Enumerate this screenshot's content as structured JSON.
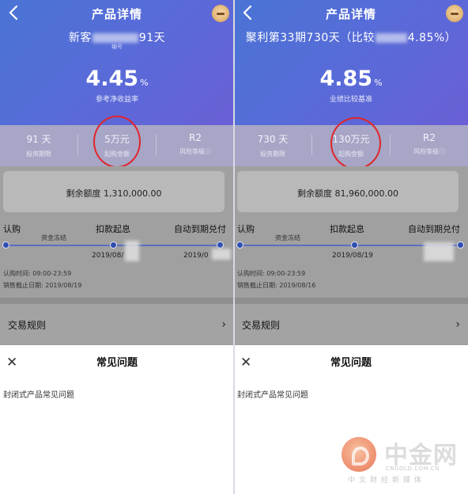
{
  "left": {
    "nav_title": "产品详情",
    "product_name_prefix": "新客",
    "product_name_suffix": "91天",
    "product_sub": "编号",
    "rate_value": "4.45",
    "rate_unit": "%",
    "rate_label": "参考净收益率",
    "stats": [
      {
        "value": "91 天",
        "label": "投资期限"
      },
      {
        "value": "5万元",
        "label": "起购金额"
      },
      {
        "value": "R2",
        "label": "风险等级"
      }
    ],
    "remaining": "剩余额度 1,310,000.00",
    "steps": [
      "认购",
      "扣款起息",
      "自动到期兑付"
    ],
    "freeze_label": "资金冻结",
    "date_a": "2019/08/",
    "date_b": "2019/0",
    "info_1": "认购时间: 09:00-23:59",
    "info_2": "销售截止日期: 2019/08/19",
    "rules_label": "交易规则",
    "faq_title": "常见问题",
    "faq_item": "封闭式产品常见问题"
  },
  "right": {
    "nav_title": "产品详情",
    "product_name_prefix": "聚利第33期730天（比较",
    "product_name_suffix": "4.85%）",
    "product_sub": "",
    "rate_value": "4.85",
    "rate_unit": "%",
    "rate_label": "业绩比较基准",
    "stats": [
      {
        "value": "730 天",
        "label": "投资期限"
      },
      {
        "value": "130万元",
        "label": "起购金额"
      },
      {
        "value": "R2",
        "label": "风险等级"
      }
    ],
    "remaining": "剩余额度 81,960,000.00",
    "steps": [
      "认购",
      "扣款起息",
      "自动到期兑付"
    ],
    "freeze_label": "资金冻结",
    "date_a": "2019/08/19",
    "date_b": "",
    "info_1": "认购时间: 09:00-23:59",
    "info_2": "销售截止日期: 2019/08/16",
    "rules_label": "交易规则",
    "faq_title": "常见问题",
    "faq_item": "封闭式产品常见问题"
  },
  "icons": {
    "back": "chevron-left-icon",
    "avatar": "robot-avatar-icon",
    "risk_info": "info-icon",
    "chevron": "chevron-right-icon",
    "close": "close-icon"
  },
  "symbols": {
    "chevron": "›",
    "close": "✕",
    "info": "ⓘ"
  },
  "watermark": {
    "brand": "中金网",
    "url": "CNGOLD.COM.CN",
    "tagline": "中文财经新媒体"
  },
  "colors": {
    "hero_start": "#4a74d6",
    "hero_end": "#6a5fd6",
    "highlight_circle": "#e0262b",
    "timeline": "#2f4fb0"
  }
}
